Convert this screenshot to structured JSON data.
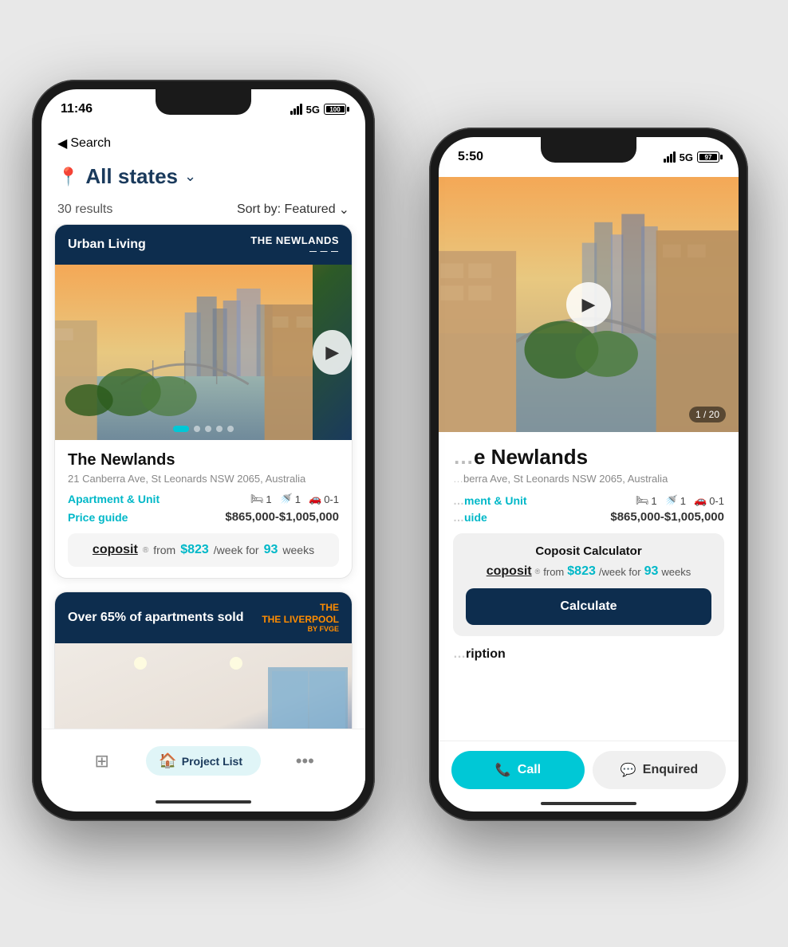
{
  "front_phone": {
    "status_bar": {
      "time": "11:46",
      "signal": "5G",
      "battery": "100"
    },
    "nav": {
      "back_label": "Search"
    },
    "location": {
      "title": "All states",
      "icon": "📍"
    },
    "results": {
      "count": "30 results",
      "sort_label": "Sort by: Featured"
    },
    "card1": {
      "header_label": "Urban Living",
      "header_logo_line1": "THE NEWLANDS",
      "header_logo_line2": "",
      "property_name": "The Newlands",
      "address": "21 Canberra Ave, St Leonards NSW 2065, Australia",
      "type": "Apartment & Unit",
      "beds": "1",
      "baths": "1",
      "cars": "0-1",
      "price_label": "Price guide",
      "price_value": "$865,000-$1,005,000",
      "coposit_amount": "$823",
      "coposit_weeks": "93"
    },
    "card2": {
      "header_label": "Over 65% of apartments sold",
      "header_logo": "THE LIVERPOOL"
    },
    "tab_bar": {
      "grid_icon": "⊞",
      "project_list_icon": "🏠",
      "project_list_label": "Project List",
      "more_icon": "•••"
    }
  },
  "back_phone": {
    "status_bar": {
      "time": "5:50",
      "signal": "5G",
      "battery": "97"
    },
    "property_name": "e Newlands",
    "address": "berra Ave, St Leonards NSW 2065, Australia",
    "type": "ment & Unit",
    "price_label": "uide",
    "beds": "1",
    "baths": "1",
    "cars": "0-1",
    "price_value": "$865,000-$1,005,000",
    "image_counter": "1 / 20",
    "coposit_section": {
      "title": "Coposit Calculator",
      "amount": "$823",
      "weeks": "93",
      "calc_button": "Calculate"
    },
    "description_label": "ription",
    "call_button": "Call",
    "enquire_button": "Enquired"
  }
}
